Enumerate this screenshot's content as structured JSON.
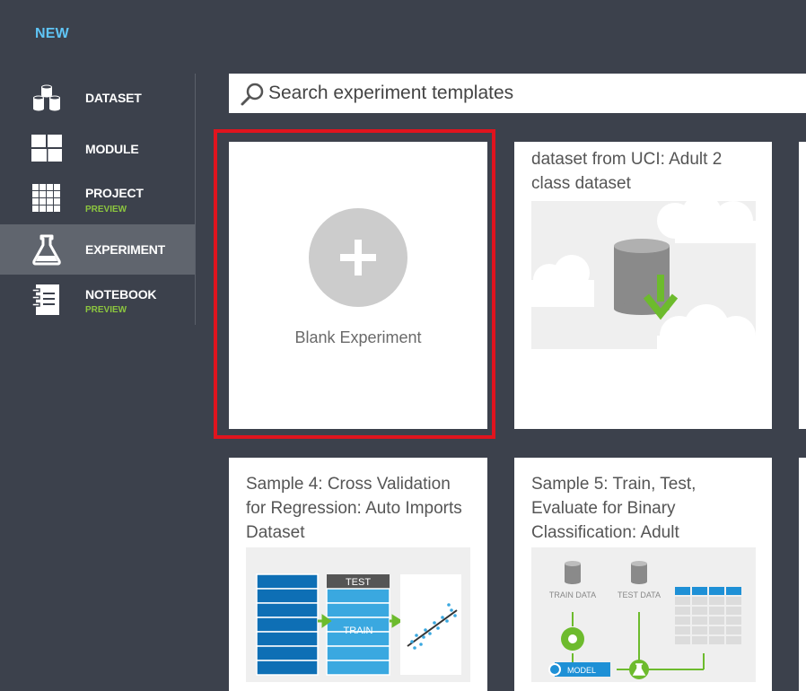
{
  "header": {
    "new_label": "NEW"
  },
  "nav": {
    "items": [
      {
        "label": "DATASET",
        "icon": "dataset-icon"
      },
      {
        "label": "MODULE",
        "icon": "module-icon"
      },
      {
        "label": "PROJECT",
        "sub": "PREVIEW",
        "icon": "project-icon"
      },
      {
        "label": "EXPERIMENT",
        "icon": "flask-icon",
        "active": true
      },
      {
        "label": "NOTEBOOK",
        "sub": "PREVIEW",
        "icon": "notebook-icon"
      }
    ]
  },
  "search": {
    "placeholder": "Search experiment templates",
    "value": ""
  },
  "cards": {
    "blank": {
      "label": "Blank Experiment"
    },
    "uci": {
      "title": "dataset from UCI: Adult 2 class dataset"
    },
    "sample4": {
      "title": "Sample 4: Cross Validation for Regression: Auto Imports Dataset"
    },
    "sample5": {
      "title": "Sample 5: Train, Test, Evaluate for Binary Classification: Adult"
    }
  },
  "illustrations": {
    "sample4": {
      "test_label": "TEST",
      "train_label": "TRAIN"
    },
    "sample5": {
      "train_data": "TRAIN DATA",
      "test_data": "TEST DATA",
      "model": "MODEL"
    }
  },
  "colors": {
    "accent": "#5fc5f6",
    "preview": "#8cc63f",
    "highlight": "#e0141e",
    "background": "#3c414c"
  }
}
